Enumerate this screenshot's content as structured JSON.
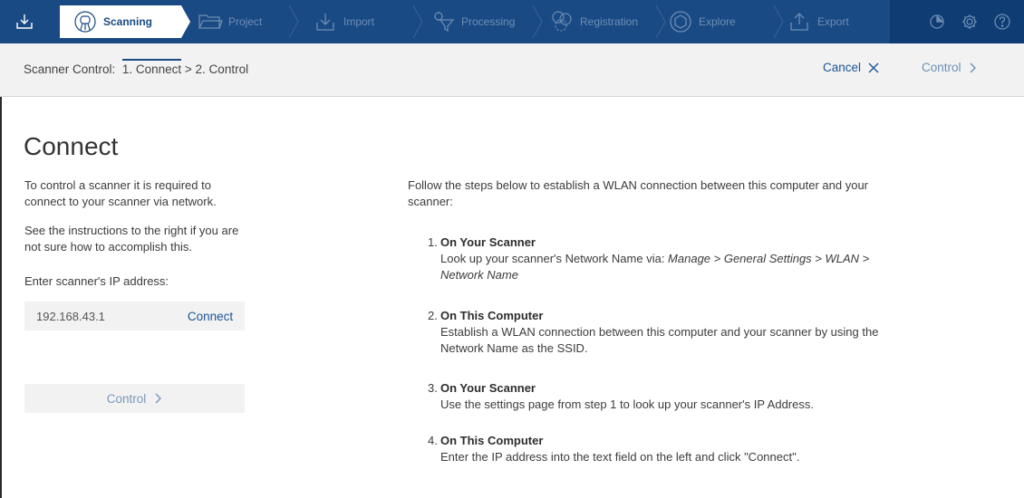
{
  "topbar": {
    "steps": [
      {
        "label": "Scanning",
        "icon": "scanner-icon",
        "active": true
      },
      {
        "label": "Project",
        "icon": "folder-icon"
      },
      {
        "label": "Import",
        "icon": "import-icon"
      },
      {
        "label": "Processing",
        "icon": "processing-icon"
      },
      {
        "label": "Registration",
        "icon": "registration-icon"
      },
      {
        "label": "Explore",
        "icon": "explore-icon"
      },
      {
        "label": "Export",
        "icon": "export-icon"
      }
    ],
    "right_icons": [
      "pie-chart-icon",
      "gear-icon",
      "help-icon"
    ]
  },
  "subheader": {
    "prefix": "Scanner Control:",
    "step1": "1. Connect",
    "sep": ">",
    "step2": "2. Control",
    "cancel_label": "Cancel",
    "control_label": "Control"
  },
  "connect": {
    "title": "Connect",
    "para1": "To control a scanner it is required to connect to your scanner via network.",
    "para2": "See the instructions to the right if you are not sure how to accomplish this.",
    "ip_label": "Enter scanner's IP address:",
    "ip_value": "192.168.43.1",
    "connect_button": "Connect",
    "control_button": "Control"
  },
  "instructions": {
    "intro": "Follow the steps below to establish a WLAN connection between this computer and your scanner:",
    "steps": [
      {
        "num": "1.",
        "title": "On Your Scanner",
        "body_pre": "Look up your scanner's Network Name via: ",
        "body_em": "Manage > General Settings > WLAN > Network Name"
      },
      {
        "num": "2.",
        "title": "On This Computer",
        "body": "Establish a WLAN connection between this computer and your scanner by using the Network Name as the SSID."
      },
      {
        "num": "3.",
        "title": "On Your Scanner",
        "body": "Use the settings page from step 1 to look up your scanner's IP Address."
      },
      {
        "num": "4.",
        "title": "On This Computer",
        "body": "Enter the IP address into the text field on the left and click \"Connect\"."
      }
    ]
  },
  "colors": {
    "topbar": "#1a4a84",
    "topbar_right": "#0e3c73",
    "accent_text": "#1a5596",
    "subheader_bg": "#f2f2f2"
  }
}
